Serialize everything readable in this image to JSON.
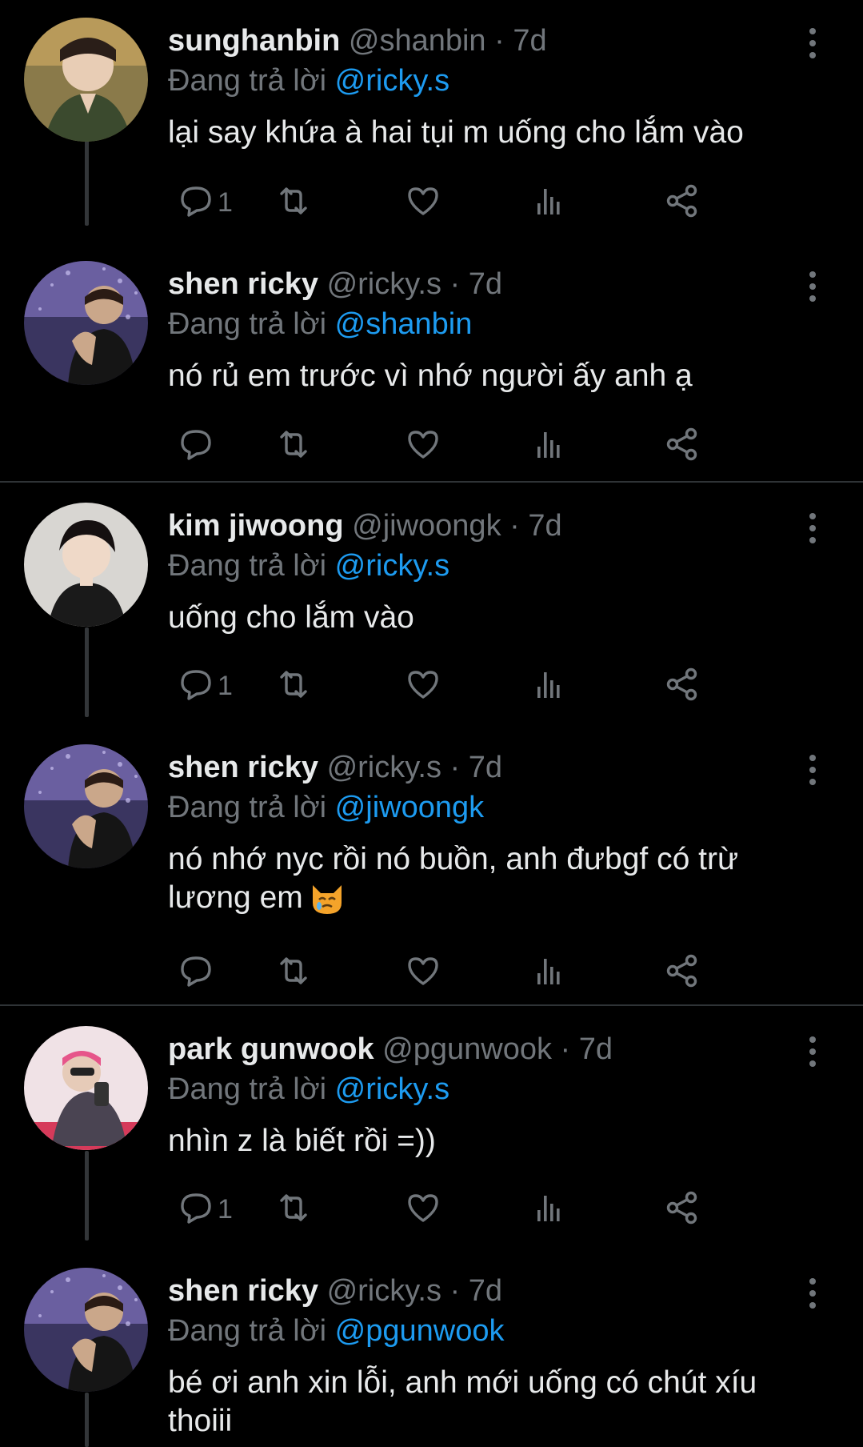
{
  "tweets": [
    {
      "display_name": "sunghanbin",
      "handle": "@shanbin",
      "dot": "·",
      "time": "7d",
      "reply_prefix": "Đang trả lời",
      "reply_to": "@ricky.s",
      "text": "lại say khứa à hai tụi m uống cho lắm vào",
      "reply_count": "1"
    },
    {
      "display_name": "shen ricky",
      "handle": "@ricky.s",
      "dot": "·",
      "time": "7d",
      "reply_prefix": "Đang trả lời",
      "reply_to": "@shanbin",
      "text": "nó rủ em trước vì nhớ người ấy anh ạ",
      "reply_count": ""
    },
    {
      "display_name": "kim jiwoong",
      "handle": "@jiwoongk",
      "dot": "·",
      "time": "7d",
      "reply_prefix": "Đang trả lời",
      "reply_to": "@ricky.s",
      "text": "uống cho lắm vào",
      "reply_count": "1"
    },
    {
      "display_name": "shen ricky",
      "handle": "@ricky.s",
      "dot": "·",
      "time": "7d",
      "reply_prefix": "Đang trả lời",
      "reply_to": "@jiwoongk",
      "text": "nó nhớ nyc rồi nó buồn, anh đưbgf có trừ lương em",
      "reply_count": ""
    },
    {
      "display_name": "park gunwook",
      "handle": "@pgunwook",
      "dot": "·",
      "time": "7d",
      "reply_prefix": "Đang trả lời",
      "reply_to": "@ricky.s",
      "text": "nhìn z là biết rồi =))",
      "reply_count": "1"
    },
    {
      "display_name": "shen ricky",
      "handle": "@ricky.s",
      "dot": "·",
      "time": "7d",
      "reply_prefix": "Đang trả lời",
      "reply_to": "@pgunwook",
      "text": "bé ơi anh xin lỗi, anh mới uống có chút xíu thoiii",
      "reply_count": ""
    }
  ],
  "icons": {
    "reply": "reply-icon",
    "retweet": "retweet-icon",
    "like": "heart-icon",
    "views": "views-icon",
    "share": "share-icon",
    "more": "more-vertical-icon",
    "emoji": "crying-cat-emoji"
  },
  "colors": {
    "background": "#000000",
    "text_primary": "#e7e9ea",
    "text_secondary": "#71767b",
    "accent": "#1d9bf0",
    "divider": "#2f3336"
  }
}
